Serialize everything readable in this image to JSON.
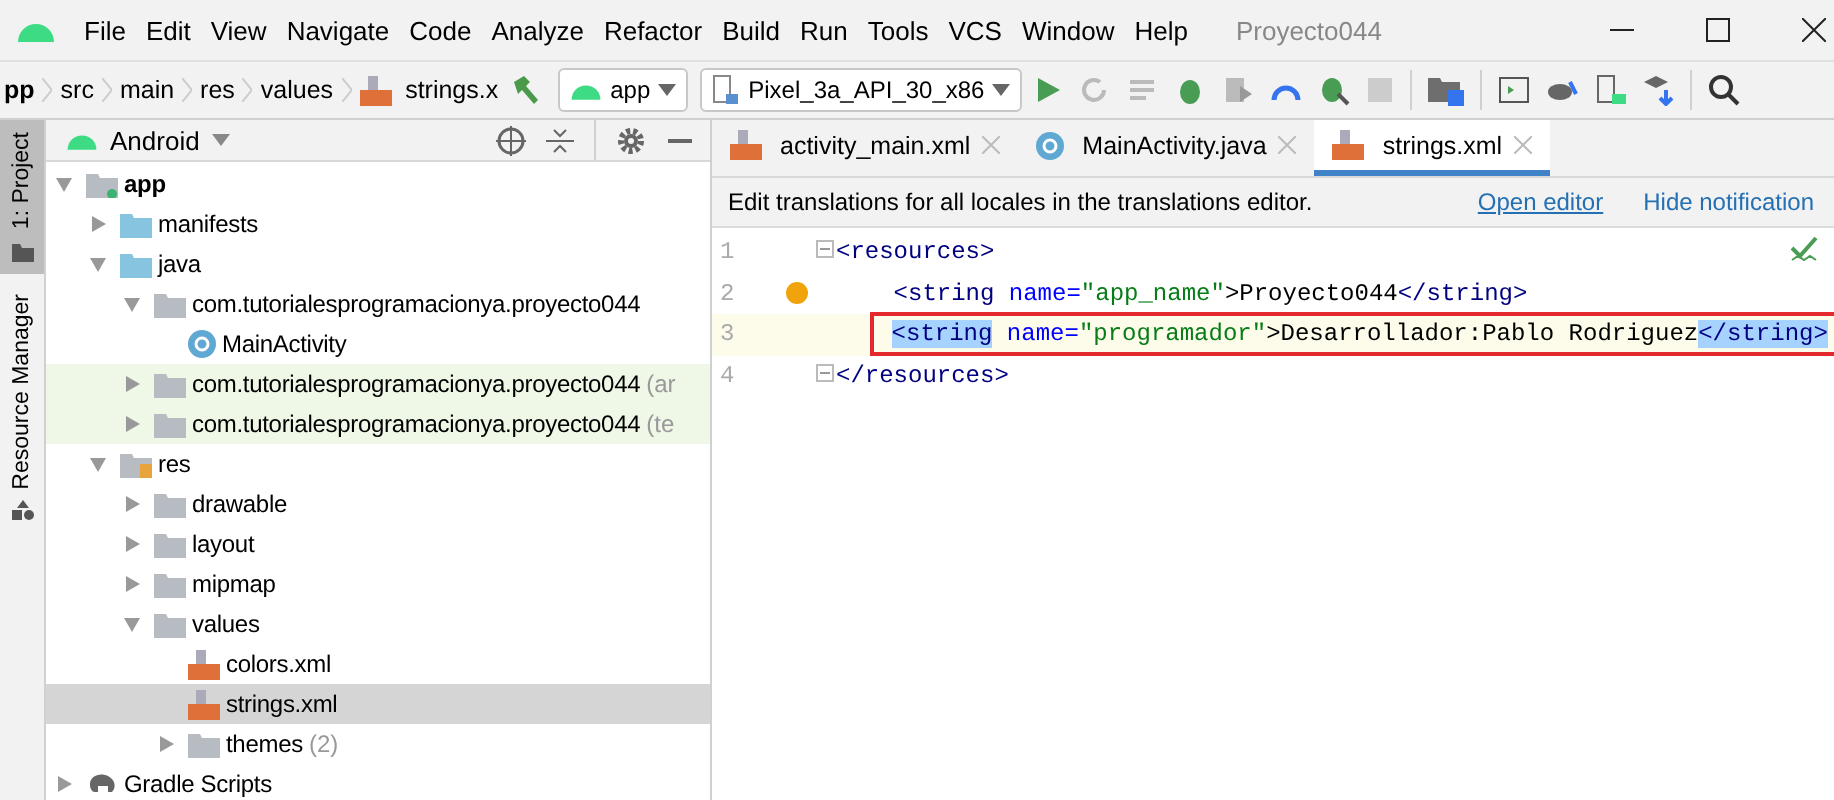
{
  "menu": [
    "File",
    "Edit",
    "View",
    "Navigate",
    "Code",
    "Analyze",
    "Refactor",
    "Build",
    "Run",
    "Tools",
    "VCS",
    "Window",
    "Help"
  ],
  "window": {
    "title": "Proyecto044"
  },
  "breadcrumbs": [
    {
      "label": "pp",
      "kind": "folder"
    },
    {
      "label": "src",
      "kind": "folder"
    },
    {
      "label": "main",
      "kind": "folder"
    },
    {
      "label": "res",
      "kind": "folder"
    },
    {
      "label": "values",
      "kind": "folder"
    },
    {
      "label": "strings.x",
      "kind": "xml"
    }
  ],
  "run_config": {
    "value": "app"
  },
  "device": {
    "value": "Pixel_3a_API_30_x86"
  },
  "side_tabs": [
    {
      "label": "1: Project",
      "selected": true
    },
    {
      "label": "Resource Manager",
      "selected": false
    }
  ],
  "project_panel": {
    "view": "Android"
  },
  "tree": [
    {
      "label": "app",
      "kind": "module",
      "expanded": true,
      "selected": false,
      "tinted": false,
      "children": [
        {
          "label": "manifests",
          "kind": "folder",
          "expanded": false,
          "selected": false,
          "tinted": false
        },
        {
          "label": "java",
          "kind": "folder",
          "expanded": true,
          "selected": false,
          "tinted": false,
          "children": [
            {
              "label": "com.tutorialesprogramacionya.proyecto044",
              "kind": "package",
              "expanded": true,
              "selected": false,
              "tinted": false,
              "children": [
                {
                  "label": "MainActivity",
                  "kind": "class",
                  "selected": false,
                  "tinted": false
                }
              ]
            },
            {
              "label": "com.tutorialesprogramacionya.proyecto044",
              "suffix": "(ar",
              "kind": "package",
              "expanded": false,
              "selected": false,
              "tinted": true
            },
            {
              "label": "com.tutorialesprogramacionya.proyecto044",
              "suffix": "(te",
              "kind": "package",
              "expanded": false,
              "selected": false,
              "tinted": true
            }
          ]
        },
        {
          "label": "res",
          "kind": "res",
          "expanded": true,
          "selected": false,
          "tinted": false,
          "children": [
            {
              "label": "drawable",
              "kind": "package",
              "expanded": false,
              "selected": false,
              "tinted": false
            },
            {
              "label": "layout",
              "kind": "package",
              "expanded": false,
              "selected": false,
              "tinted": false
            },
            {
              "label": "mipmap",
              "kind": "package",
              "expanded": false,
              "selected": false,
              "tinted": false
            },
            {
              "label": "values",
              "kind": "package",
              "expanded": true,
              "selected": false,
              "tinted": false,
              "children": [
                {
                  "label": "colors.xml",
                  "kind": "xml",
                  "selected": false,
                  "tinted": false
                },
                {
                  "label": "strings.xml",
                  "kind": "xml",
                  "selected": true,
                  "tinted": false
                },
                {
                  "label": "themes",
                  "suffix": "(2)",
                  "kind": "package",
                  "expanded": false,
                  "selected": false,
                  "tinted": false
                }
              ]
            }
          ]
        }
      ]
    },
    {
      "label": "Gradle Scripts",
      "kind": "gradle",
      "expanded": false,
      "selected": false,
      "tinted": false
    }
  ],
  "editor_tabs": [
    {
      "label": "activity_main.xml",
      "kind": "xml",
      "selected": false
    },
    {
      "label": "MainActivity.java",
      "kind": "class",
      "selected": false
    },
    {
      "label": "strings.xml",
      "kind": "xml",
      "selected": true
    }
  ],
  "notification": {
    "text": "Edit translations for all locales in the translations editor.",
    "links": [
      "Open editor",
      "Hide notification"
    ]
  },
  "code_lines": [
    {
      "number": "1",
      "fold": true,
      "bulb": false,
      "current": false,
      "boxed": false,
      "nested": false,
      "tokens": [
        {
          "text": "<resources>",
          "kind": "tag",
          "highlight": false
        }
      ]
    },
    {
      "number": "2",
      "fold": false,
      "bulb": true,
      "current": false,
      "boxed": false,
      "nested": true,
      "tokens": [
        {
          "text": "<string ",
          "kind": "tag",
          "highlight": false
        },
        {
          "text": "name=",
          "kind": "attr",
          "highlight": false
        },
        {
          "text": "\"app_name\"",
          "kind": "value",
          "highlight": false
        },
        {
          "text": ">Proyecto044",
          "kind": "text",
          "highlight": false
        },
        {
          "text": "</string>",
          "kind": "tag",
          "highlight": false
        }
      ]
    },
    {
      "number": "3",
      "fold": false,
      "bulb": false,
      "current": true,
      "boxed": true,
      "nested": true,
      "tokens": [
        {
          "text": "<string",
          "kind": "tag",
          "highlight": true
        },
        {
          "text": " name=",
          "kind": "attr",
          "highlight": false
        },
        {
          "text": "\"programador\"",
          "kind": "value",
          "highlight": false
        },
        {
          "text": ">Desarrollador:Pablo Rodriguez",
          "kind": "text",
          "highlight": false
        },
        {
          "text": "</string>",
          "kind": "tag",
          "highlight": true
        }
      ]
    },
    {
      "number": "4",
      "fold": true,
      "bulb": false,
      "current": false,
      "boxed": false,
      "nested": false,
      "tokens": [
        {
          "text": "</resources>",
          "kind": "tag",
          "highlight": false
        }
      ]
    }
  ]
}
